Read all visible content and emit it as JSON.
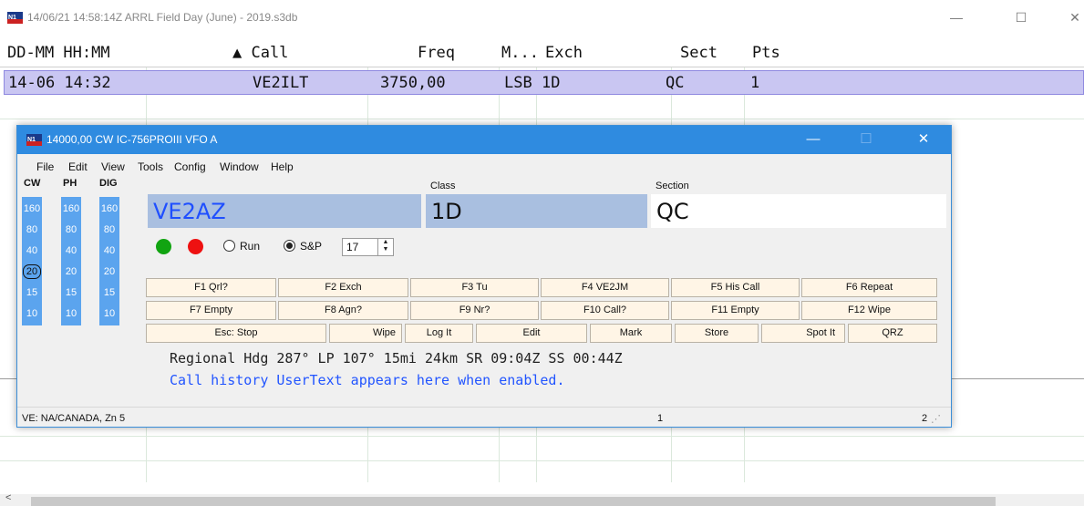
{
  "log_window": {
    "title": "14/06/21 14:58:14Z  ARRL Field Day (June) - 2019.s3db",
    "controls": {
      "minimize": "—",
      "maximize": "☐",
      "close": "✕"
    },
    "columns": [
      "DD-MM HH:MM",
      "▲ Call",
      "Freq",
      "M...",
      "Exch",
      "Sect",
      "Pts"
    ],
    "rows": [
      {
        "datetime": "14-06 14:32",
        "call": "VE2ILT",
        "freq": "3750,00",
        "mode": "LSB",
        "exch": "1D",
        "sect": "QC",
        "pts": "1"
      }
    ],
    "scroll_left": "<"
  },
  "entry_window": {
    "title": "14000,00 CW IC-756PROIII VFO A",
    "controls": {
      "minimize": "—",
      "maximize": "☐",
      "close": "✕"
    },
    "menu": [
      "File",
      "Edit",
      "View",
      "Tools",
      "Config",
      "Window",
      "Help"
    ],
    "bands": {
      "headers": [
        "CW",
        "PH",
        "DIG"
      ],
      "values": [
        "160",
        "80",
        "40",
        "20",
        "15",
        "10"
      ],
      "selected": {
        "column": "CW",
        "value": "20"
      }
    },
    "fields": {
      "call": {
        "label": "",
        "value": "VE2AZ"
      },
      "class": {
        "label": "Class",
        "value": "1D"
      },
      "section": {
        "label": "Section",
        "value": "QC"
      }
    },
    "mode_radio": {
      "run_label": "Run",
      "sp_label": "S&P",
      "selected": "S&P"
    },
    "spin_value": "17",
    "buttons_row1": [
      "F1 Qrl?",
      "F2 Exch",
      "F3 Tu",
      "F4 VE2JM",
      "F5 His Call",
      "F6 Repeat"
    ],
    "buttons_row2": [
      "F7 Empty",
      "F8 Agn?",
      "F9 Nr?",
      "F10 Call?",
      "F11 Empty",
      "F12 Wipe"
    ],
    "buttons_row3": [
      "Esc: Stop",
      "Wipe",
      "Log It",
      "Edit",
      "Mark",
      "Store",
      "Spot It",
      "QRZ"
    ],
    "info_line": "Regional Hdg 287° LP 107° 15mi 24km SR 09:04Z SS 00:44Z",
    "user_text": "Call history UserText appears here when enabled.",
    "status": {
      "left": "VE: NA/CANADA, Zn 5",
      "center": "1",
      "right": "2"
    },
    "colors": {
      "titlebar": "#2f8be0",
      "bands": "#5ba4ee",
      "field_bg": "#a9bfe0",
      "call_text": "#1f4fff"
    }
  }
}
